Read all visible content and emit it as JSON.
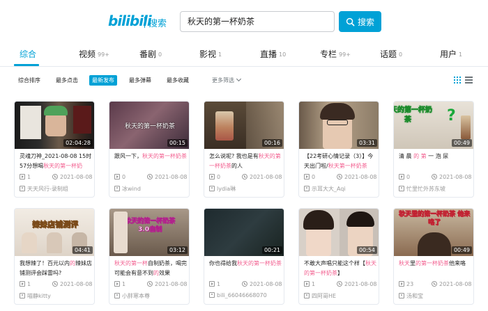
{
  "header": {
    "logo": "bilibili",
    "logo_sub": "搜索",
    "search_value": "秋天的第一杯奶茶",
    "search_button": "搜索"
  },
  "tabs": [
    {
      "label": "综合",
      "count": ""
    },
    {
      "label": "视频",
      "count": "99+"
    },
    {
      "label": "番剧",
      "count": "0"
    },
    {
      "label": "影视",
      "count": "1"
    },
    {
      "label": "直播",
      "count": "10"
    },
    {
      "label": "专栏",
      "count": "99+"
    },
    {
      "label": "话题",
      "count": "0"
    },
    {
      "label": "用户",
      "count": "1"
    }
  ],
  "filters": {
    "items": [
      "综合排序",
      "最多点击",
      "最新发布",
      "最多弹幕",
      "最多收藏"
    ],
    "more": "更多筛选"
  },
  "cards": [
    {
      "duration": "02:04:28",
      "title_parts": [
        "灵魂刀神_2021-08-08 15时57分想喝",
        "秋天的第一杯奶",
        ""
      ],
      "plays": "1",
      "date": "2021-08-08",
      "uploader": "天天风行-录制组",
      "overlay": ""
    },
    {
      "duration": "00:15",
      "title_parts": [
        "跟风一下，",
        "秋天的第一杯奶茶",
        ""
      ],
      "plays": "0",
      "date": "2021-08-08",
      "uploader": "冰wind",
      "overlay": "秋天的第一杯奶茶"
    },
    {
      "duration": "00:16",
      "title_parts": [
        "怎么说呢? 我也是有",
        "秋天的第一杯奶茶",
        "的人"
      ],
      "plays": "0",
      "date": "2021-08-08",
      "uploader": "lydia琳",
      "overlay": ""
    },
    {
      "duration": "03:31",
      "title_parts": [
        "【22考研心情记录（3）】今天出门啦/",
        "秋天第一杯奶茶",
        ""
      ],
      "plays": "0",
      "date": "2021-08-08",
      "uploader": "示耳大大_Aqi",
      "overlay": ""
    },
    {
      "duration": "00:49",
      "title_parts": [
        "清 晨 ",
        "的 第",
        " 一 泡 尿"
      ],
      "plays": "0",
      "date": "2021-08-08",
      "uploader": "忙里忙外苏东坡",
      "overlay": "秋天的第一杯奶茶"
    },
    {
      "duration": "04:41",
      "title_parts": [
        "我想辣了！百元以内",
        "的",
        "辣妹店铺测评会踩雷吗?"
      ],
      "plays": "1",
      "date": "2021-08-08",
      "uploader": "喵静kitty",
      "overlay": "辣妹店铺测评"
    },
    {
      "duration": "03:12",
      "title_parts": [
        "",
        "秋天的第一杯",
        "自制奶茶，喝完可能会有意不到",
        "的",
        "效果"
      ],
      "plays": "1",
      "date": "2021-08-08",
      "uploader": "小胖寒本尊",
      "overlay": "秋天的第一杯奶茶3.0自制"
    },
    {
      "duration": "00:21",
      "title_parts": [
        "你也得给我",
        "秋天的第一杯奶茶",
        ""
      ],
      "plays": "1",
      "date": "2021-08-08",
      "uploader": "bili_66046668070",
      "overlay": ""
    },
    {
      "duration": "00:54",
      "title_parts": [
        "不敢大声唱只能这个样【",
        "秋天的第一杯奶茶",
        "】"
      ],
      "plays": "1",
      "date": "2021-08-08",
      "uploader": "四阿哥HE",
      "overlay": ""
    },
    {
      "duration": "00:49",
      "title_parts": [
        "",
        "秋天",
        "里",
        "的第一杯奶茶",
        "他来咯"
      ],
      "plays": "23",
      "date": "2021-08-08",
      "uploader": "汤和宝",
      "overlay": "秋天里的第一杯奶茶 他来咯了"
    }
  ],
  "colors": {
    "accent": "#00a1d6",
    "highlight": "#f25d8e",
    "meta": "#999999"
  }
}
